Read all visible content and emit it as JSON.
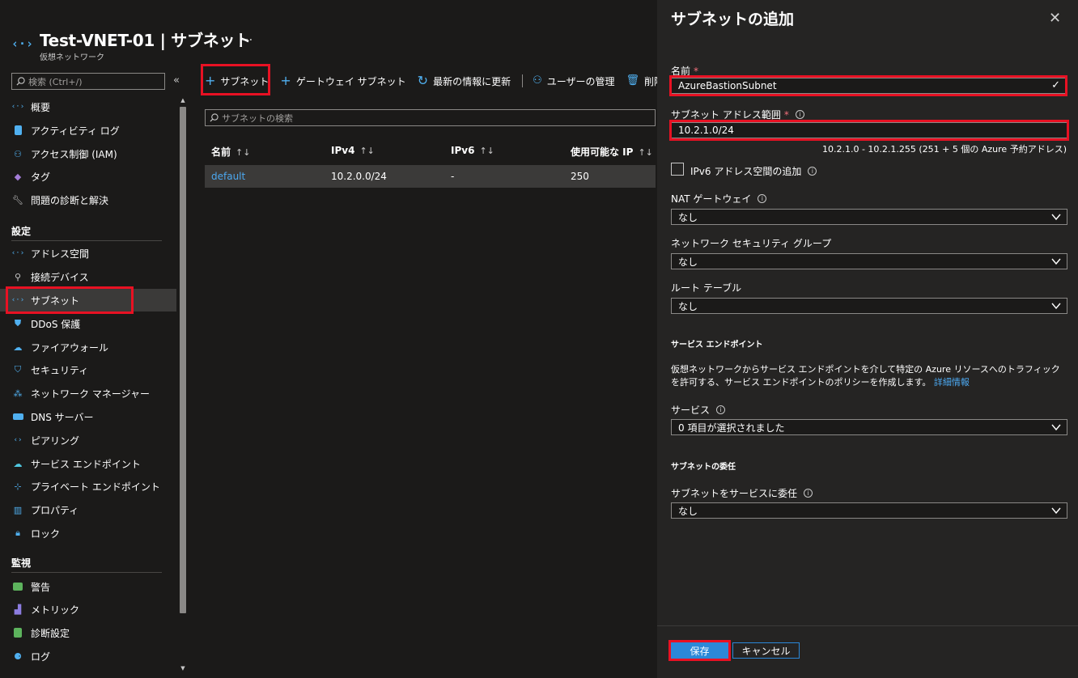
{
  "header": {
    "title": "Test-VNET-01 | サブネット",
    "subtitle": "仮想ネットワーク",
    "more": "..."
  },
  "sidebar": {
    "search_placeholder": "検索 (Ctrl+/)",
    "collapse": "«",
    "items_top": [
      {
        "label": "概要",
        "icon": "vnet-icon"
      },
      {
        "label": "アクティビティ ログ",
        "icon": "activity-log-icon"
      },
      {
        "label": "アクセス制御 (IAM)",
        "icon": "iam-icon"
      },
      {
        "label": "タグ",
        "icon": "tag-icon"
      },
      {
        "label": "問題の診断と解決",
        "icon": "wrench-icon"
      }
    ],
    "section_settings": "設定",
    "items_settings": [
      {
        "label": "アドレス空間",
        "icon": "address-space-icon"
      },
      {
        "label": "接続デバイス",
        "icon": "plug-icon"
      },
      {
        "label": "サブネット",
        "icon": "subnet-icon"
      },
      {
        "label": "DDoS 保護",
        "icon": "shield-icon"
      },
      {
        "label": "ファイアウォール",
        "icon": "firewall-icon"
      },
      {
        "label": "セキュリティ",
        "icon": "security-icon"
      },
      {
        "label": "ネットワーク マネージャー",
        "icon": "network-manager-icon"
      },
      {
        "label": "DNS サーバー",
        "icon": "dns-icon"
      },
      {
        "label": "ピアリング",
        "icon": "peering-icon"
      },
      {
        "label": "サービス エンドポイント",
        "icon": "service-endpoint-icon"
      },
      {
        "label": "プライベート エンドポイント",
        "icon": "private-endpoint-icon"
      },
      {
        "label": "プロパティ",
        "icon": "properties-icon"
      },
      {
        "label": "ロック",
        "icon": "lock-icon"
      }
    ],
    "section_monitor": "監視",
    "items_monitor": [
      {
        "label": "警告",
        "icon": "alert-icon"
      },
      {
        "label": "メトリック",
        "icon": "metrics-icon"
      },
      {
        "label": "診断設定",
        "icon": "diagnostic-icon"
      },
      {
        "label": "ログ",
        "icon": "logs-icon"
      }
    ]
  },
  "toolbar": {
    "add_subnet": "サブネット",
    "gateway_subnet": "ゲートウェイ サブネット",
    "refresh": "最新の情報に更新",
    "manage_users": "ユーザーの管理",
    "delete": "削除"
  },
  "subnets": {
    "search_placeholder": "サブネットの検索",
    "columns": [
      "名前",
      "IPv4",
      "IPv6",
      "使用可能な IP"
    ],
    "rows": [
      {
        "name": "default",
        "ipv4": "10.2.0.0/24",
        "ipv6": "-",
        "available": "250"
      }
    ]
  },
  "panel": {
    "title": "サブネットの追加",
    "close": "✕",
    "name_label": "名前",
    "required_mark": "*",
    "name_value": "AzureBastionSubnet",
    "range_label": "サブネット アドレス範囲",
    "range_value": "10.2.1.0/24",
    "range_hint": "10.2.1.0 - 10.2.1.255 (251 + 5 個の Azure 予約アドレス)",
    "ipv6_label": "IPv6 アドレス空間の追加",
    "nat_label": "NAT ゲートウェイ",
    "nat_value": "なし",
    "nsg_label": "ネットワーク セキュリティ グループ",
    "nsg_value": "なし",
    "route_label": "ルート テーブル",
    "route_value": "なし",
    "service_endpoint_heading": "サービス エンドポイント",
    "service_endpoint_desc": "仮想ネットワークからサービス エンドポイントを介して特定の Azure リソースへのトラフィックを許可する、サービス エンドポイントのポリシーを作成します。",
    "learn_more": "詳細情報",
    "services_label": "サービス",
    "services_value": "0 項目が選択されました",
    "delegation_heading": "サブネットの委任",
    "delegation_label": "サブネットをサービスに委任",
    "delegation_value": "なし",
    "save": "保存",
    "cancel": "キャンセル"
  },
  "colors": {
    "background": "#1b1a19",
    "panel": "#252423",
    "accent": "#2b88d8",
    "link": "#4ca8f0",
    "highlight": "#e81123"
  }
}
